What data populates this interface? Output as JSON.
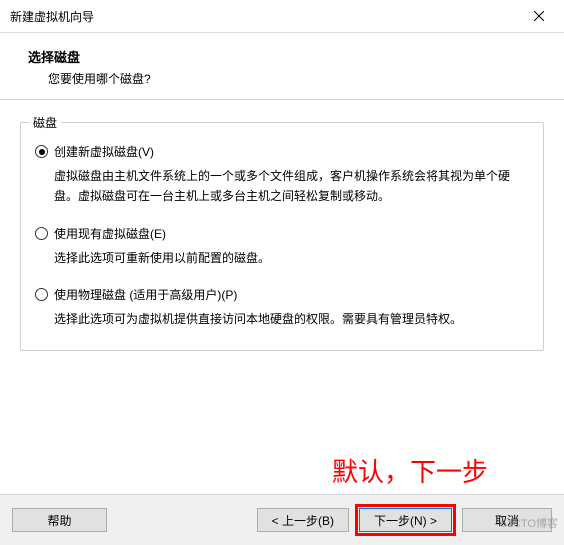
{
  "titlebar": {
    "title": "新建虚拟机向导"
  },
  "header": {
    "title": "选择磁盘",
    "subtitle": "您要使用哪个磁盘?"
  },
  "fieldset": {
    "legend": "磁盘"
  },
  "options": [
    {
      "label": "创建新虚拟磁盘(V)",
      "description": "虚拟磁盘由主机文件系统上的一个或多个文件组成，客户机操作系统会将其视为单个硬盘。虚拟磁盘可在一台主机上或多台主机之间轻松复制或移动。",
      "selected": true
    },
    {
      "label": "使用现有虚拟磁盘(E)",
      "description": "选择此选项可重新使用以前配置的磁盘。",
      "selected": false
    },
    {
      "label": "使用物理磁盘 (适用于高级用户)(P)",
      "description": "选择此选项可为虚拟机提供直接访问本地硬盘的权限。需要具有管理员特权。",
      "selected": false
    }
  ],
  "buttons": {
    "help": "帮助",
    "back": "< 上一步(B)",
    "next": "下一步(N) >",
    "cancel": "取消"
  },
  "annotation": "默认，下一步",
  "watermark": "51CTO博客"
}
